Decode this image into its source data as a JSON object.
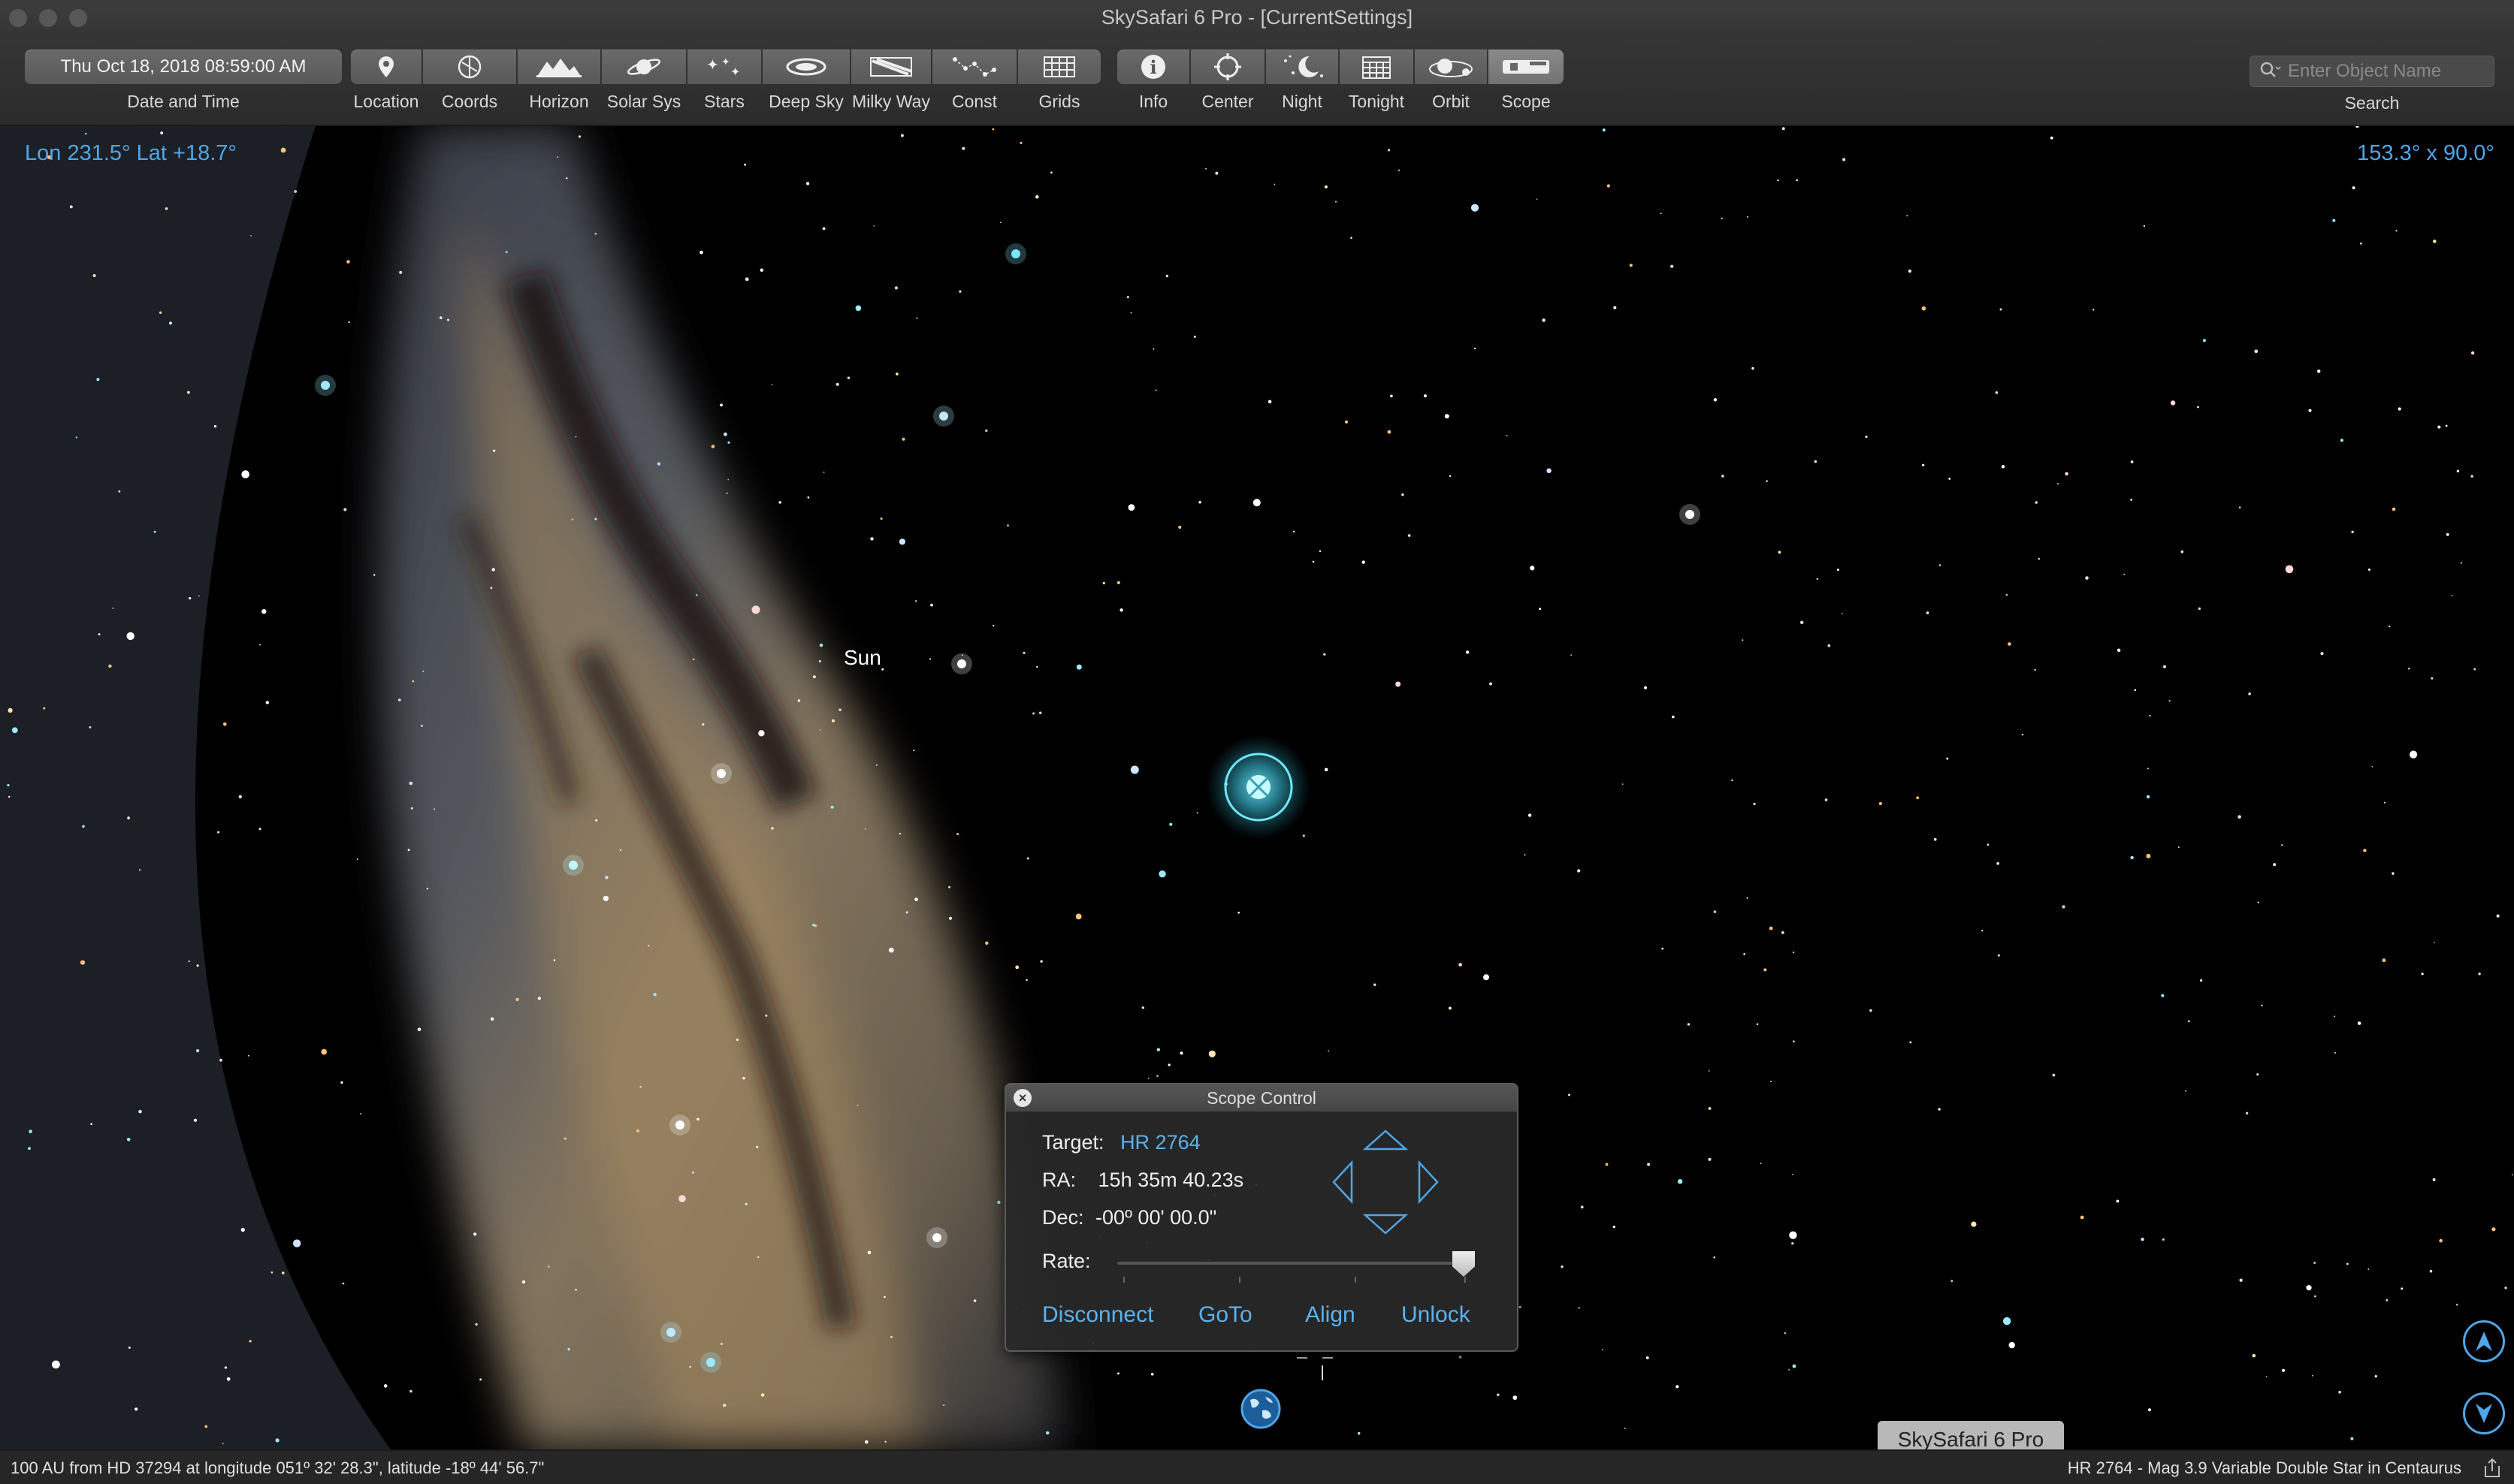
{
  "window": {
    "title": "SkySafari 6 Pro - [CurrentSettings]"
  },
  "toolbar": {
    "date_value": "Thu Oct 18, 2018  08:59:00 AM",
    "date_label": "Date and Time",
    "items": [
      {
        "label": "Location",
        "icon": "location-pin-icon"
      },
      {
        "label": "Coords",
        "icon": "coords-icon"
      },
      {
        "label": "Horizon",
        "icon": "horizon-icon"
      },
      {
        "label": "Solar Sys",
        "icon": "planet-icon"
      },
      {
        "label": "Stars",
        "icon": "stars-icon"
      },
      {
        "label": "Deep Sky",
        "icon": "galaxy-icon"
      },
      {
        "label": "Milky Way",
        "icon": "milky-way-icon"
      },
      {
        "label": "Const",
        "icon": "constellation-icon"
      },
      {
        "label": "Grids",
        "icon": "grid-icon"
      },
      {
        "label": "Info",
        "icon": "info-icon"
      },
      {
        "label": "Center",
        "icon": "center-icon"
      },
      {
        "label": "Night",
        "icon": "night-icon"
      },
      {
        "label": "Tonight",
        "icon": "calendar-icon"
      },
      {
        "label": "Orbit",
        "icon": "orbit-icon"
      },
      {
        "label": "Scope",
        "icon": "telescope-icon"
      }
    ],
    "search_placeholder": "Enter Object Name",
    "search_label": "Search"
  },
  "sky": {
    "coords_readout": "Lon 231.5° Lat +18.7°",
    "fov_readout": "153.3° x 90.0°",
    "sun_label": "Sun"
  },
  "scope_control": {
    "title": "Scope Control",
    "target_label": "Target:",
    "target_value": "HR 2764",
    "ra_label": "RA:",
    "ra_value": "15h 35m 40.23s",
    "dec_label": "Dec:",
    "dec_value": "-00º 00' 00.0\"",
    "rate_label": "Rate:",
    "rate_value": 1.0,
    "buttons": {
      "disconnect": "Disconnect",
      "goto": "GoTo",
      "align": "Align",
      "unlock": "Unlock"
    }
  },
  "status": {
    "left": "100 AU from HD 37294 at longitude 051º 32' 28.3\", latitude -18º 44' 56.7\"",
    "right": "HR 2764 - Mag 3.9 Variable Double Star in Centaurus",
    "tooltip": "SkySafari 6 Pro"
  },
  "colors": {
    "accent": "#4fa6e8",
    "link": "#5ab2f0",
    "target_glow": "#4ce0f0"
  }
}
